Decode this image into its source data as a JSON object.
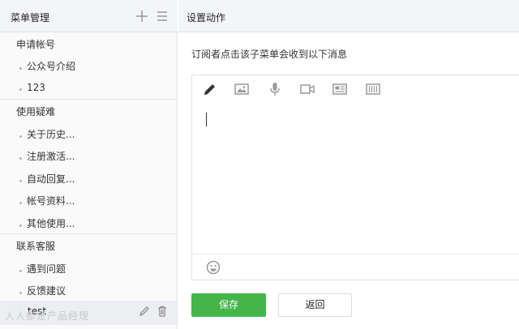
{
  "left_panel": {
    "title": "菜单管理",
    "groups": [
      {
        "label": "申请帐号",
        "children": [
          "公众号介绍",
          "123"
        ]
      },
      {
        "label": "使用疑难",
        "children": [
          "关于历史...",
          "注册激活...",
          "自动回复...",
          "帐号资料...",
          "其他使用..."
        ]
      },
      {
        "label": "联系客服",
        "children": [
          "遇到问题",
          "反馈建议"
        ]
      }
    ],
    "selected_item": "test",
    "watermark": "人人都是产品经理"
  },
  "right_panel": {
    "title": "设置动作",
    "description": "订阅者点击该子菜单会收到以下消息",
    "toolbar": [
      "text-icon",
      "image-icon",
      "voice-icon",
      "video-icon",
      "news-icon",
      "card-icon"
    ],
    "editor_text": ""
  },
  "buttons": {
    "save": "保存",
    "back": "返回"
  },
  "colors": {
    "accent": "#44b549",
    "header_bg": "#f4f5f9",
    "icon": "#9a9a9a"
  }
}
